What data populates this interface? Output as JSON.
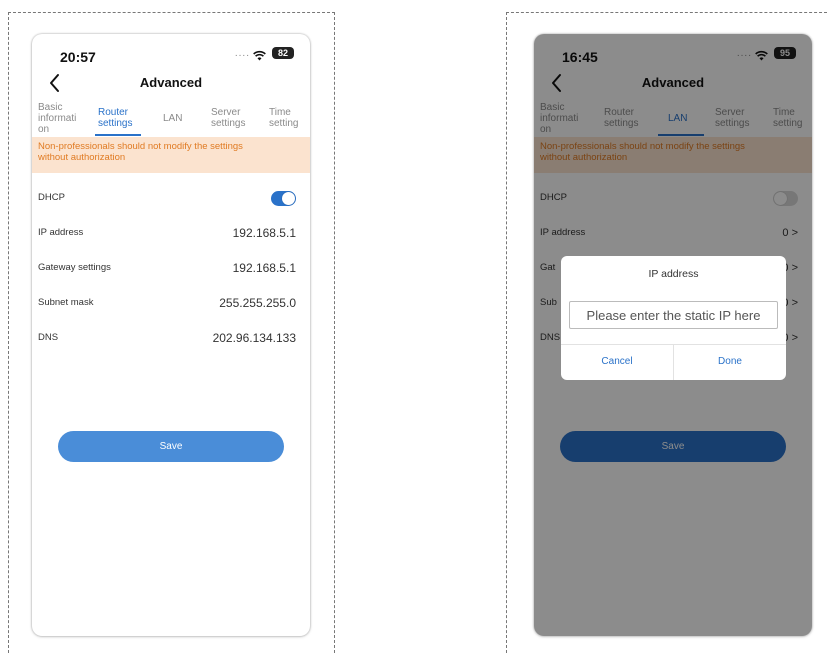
{
  "screens": [
    {
      "status": {
        "time": "20:57",
        "signal": "....",
        "battery": "82"
      },
      "nav": {
        "title": "Advanced"
      },
      "tabs": [
        {
          "label_lines": [
            "Basic",
            "informati",
            "on"
          ]
        },
        {
          "label_lines": [
            "Router",
            "settings"
          ]
        },
        {
          "label_lines": [
            "LAN"
          ]
        },
        {
          "label_lines": [
            "Server",
            "settings"
          ]
        },
        {
          "label_lines": [
            "Time",
            "setting"
          ]
        }
      ],
      "active_tab": "Router settings",
      "warning_lines": [
        "Non-professionals should not modify the settings",
        "without authorization"
      ],
      "fields": [
        {
          "label": "DHCP",
          "toggle_on": true
        },
        {
          "label": "IP address",
          "value": "192.168.5.1"
        },
        {
          "label": "Gateway settings",
          "value": "192.168.5.1"
        },
        {
          "label": "Subnet mask",
          "value": "255.255.255.0"
        },
        {
          "label": "DNS",
          "value": "202.96.134.133"
        }
      ],
      "save_label": "Save"
    },
    {
      "status": {
        "time": "16:45",
        "signal": "....",
        "battery": "95"
      },
      "nav": {
        "title": "Advanced"
      },
      "tabs": [
        {
          "label_lines": [
            "Basic",
            "informati",
            "on"
          ]
        },
        {
          "label_lines": [
            "Router",
            "settings"
          ]
        },
        {
          "label_lines": [
            "LAN"
          ]
        },
        {
          "label_lines": [
            "Server",
            "settings"
          ]
        },
        {
          "label_lines": [
            "Time",
            "setting"
          ]
        }
      ],
      "active_tab": "LAN",
      "warning_lines": [
        "Non-professionals should not modify the settings",
        "without authorization"
      ],
      "fields": [
        {
          "label": "DHCP",
          "toggle_on": false
        },
        {
          "label": "IP address",
          "value": "0 >"
        },
        {
          "label": "Gat",
          "value": "0 >"
        },
        {
          "label": "Sub",
          "value": "0 >"
        },
        {
          "label": "DNS",
          "value": "0 >"
        }
      ],
      "save_label": "Save",
      "dialog": {
        "title": "IP address",
        "placeholder": "Please enter the static IP here",
        "cancel_label": "Cancel",
        "done_label": "Done"
      }
    }
  ],
  "colors": {
    "accent": "#2a72c9",
    "save_button": "#4a8dd8",
    "warning_bg": "#fbe3cf",
    "warning_text": "#e07b23"
  }
}
